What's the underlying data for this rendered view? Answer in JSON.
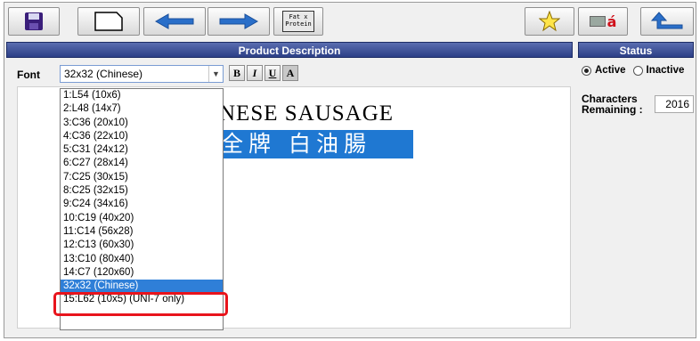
{
  "toolbar": {
    "buttons": [
      {
        "name": "save",
        "icon": "save-icon"
      },
      {
        "name": "new",
        "icon": "new-document-icon"
      },
      {
        "name": "previous",
        "icon": "arrow-left-icon"
      },
      {
        "name": "next",
        "icon": "arrow-right-icon"
      },
      {
        "name": "format",
        "icon": "font-format-icon",
        "text": "Fat\nProtein"
      },
      {
        "name": "favorite",
        "icon": "star-icon"
      },
      {
        "name": "language",
        "icon": "language-icon",
        "text": "á"
      },
      {
        "name": "back",
        "icon": "return-arrow-icon"
      }
    ]
  },
  "product_description": {
    "header": "Product Description",
    "font_label": "Font",
    "font_selected": "32x32 (Chinese)",
    "format_buttons": [
      "B",
      "I",
      "U",
      "A"
    ],
    "line1": "NESE SAUSAGE",
    "line2": "全牌 白油腸",
    "font_options": [
      "1:L54 (10x6)",
      "2:L48 (14x7)",
      "3:C36 (20x10)",
      "4:C36 (22x10)",
      "5:C31 (24x12)",
      "6:C27 (28x14)",
      "7:C25 (30x15)",
      "8:C25 (32x15)",
      "9:C24 (34x16)",
      "10:C19 (40x20)",
      "11:C14 (56x28)",
      "12:C13 (60x30)",
      "13:C10 (80x40)",
      "14:C7 (120x60)",
      "32x32 (Chinese)",
      "15:L62 (10x5) (UNI-7 only)"
    ],
    "selected_index": 14
  },
  "status": {
    "header": "Status",
    "active_label": "Active",
    "inactive_label": "Inactive",
    "active_selected": true,
    "chars_label_1": "Characters",
    "chars_label_2": "Remaining :",
    "chars_value": "2016"
  },
  "colors": {
    "header_bg": "#2c3f86",
    "selection": "#1f78d2",
    "highlight_box": "#e8141c"
  }
}
